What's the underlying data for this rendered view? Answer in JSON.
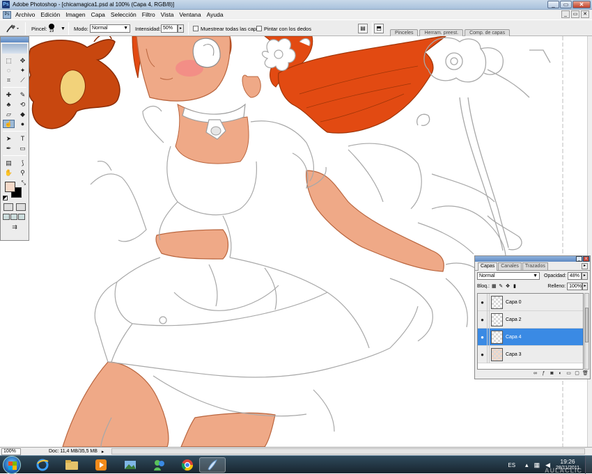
{
  "window": {
    "title": "Adobe Photoshop - [chicamagica1.psd al 100% (Capa 4, RGB/8)]",
    "app_icon": "Ps",
    "controls": [
      "minimize-icon",
      "maximize-icon",
      "close-icon"
    ],
    "control_glyphs": [
      "_",
      "▭",
      "✕"
    ]
  },
  "menu": {
    "items": [
      "Archivo",
      "Edición",
      "Imagen",
      "Capa",
      "Selección",
      "Filtro",
      "Vista",
      "Ventana",
      "Ayuda"
    ],
    "doc_controls": [
      "_",
      "▭",
      "✕"
    ]
  },
  "options": {
    "brush_label": "Pincel:",
    "brush_size": "19",
    "mode_label": "Modo:",
    "mode_value": "Normal",
    "intensity_label": "Intensidad:",
    "intensity_value": "50%",
    "sample_all_label": "Muestrear todas las capas",
    "finger_paint_label": "Pintar con los dedos",
    "well_tabs": [
      "Pinceles",
      "Herram. preest.",
      "Comp. de capas"
    ]
  },
  "tools": {
    "active": "smudge-tool",
    "foreground_color": "#f6d9c8",
    "background_color": "#000000"
  },
  "layers_panel": {
    "tabs": [
      "Capas",
      "Canales",
      "Trazados"
    ],
    "blend_mode": "Normal",
    "opacity_label": "Opacidad:",
    "opacity_value": "48%",
    "lock_label": "Bloq.:",
    "fill_label": "Relleno:",
    "fill_value": "100%",
    "layers": [
      {
        "name": "Capa 0",
        "visible": true,
        "selected": false
      },
      {
        "name": "Capa 2",
        "visible": true,
        "selected": false
      },
      {
        "name": "Capa 4",
        "visible": true,
        "selected": true
      },
      {
        "name": "Capa 3",
        "visible": true,
        "selected": false
      }
    ],
    "footer_icons": [
      "link-icon",
      "fx-icon",
      "mask-icon",
      "adjustment-icon",
      "group-icon",
      "new-layer-icon",
      "trash-icon"
    ]
  },
  "status": {
    "zoom": "100%",
    "doc_info": "Doc: 11,4 MB/35,5 MB"
  },
  "taskbar": {
    "apps": [
      "internet-explorer-icon",
      "folder-icon",
      "media-player-icon",
      "photo-app-icon",
      "messenger-icon",
      "chrome-icon",
      "photoshop-icon"
    ],
    "language": "ES",
    "time": "19:26",
    "date": "28/11/2011"
  },
  "watermark": "AULACLIC",
  "colors": {
    "hair": "#e24a12",
    "hair_dark": "#b83a0c",
    "skin": "#efa987",
    "skin_dark": "#d9876a",
    "blush": "#f38a86",
    "selected_layer": "#3a8ae4",
    "sketch": "#a8a8a8"
  }
}
